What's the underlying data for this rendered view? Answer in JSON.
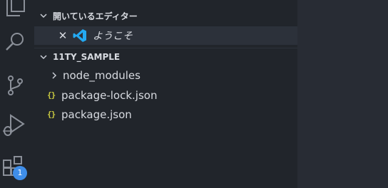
{
  "activity_bar": {
    "items": [
      {
        "name": "explorer",
        "icon": "files-icon"
      },
      {
        "name": "search",
        "icon": "search-icon"
      },
      {
        "name": "source-control",
        "icon": "source-control-icon"
      },
      {
        "name": "run-debug",
        "icon": "run-debug-icon"
      },
      {
        "name": "extensions",
        "icon": "extensions-icon",
        "badge": "1"
      }
    ]
  },
  "sidebar": {
    "open_editors": {
      "title": "開いているエディター",
      "items": [
        {
          "close": "✕",
          "icon": "vscode-icon",
          "label": "ようこそ"
        }
      ]
    },
    "project": {
      "title": "11TY_SAMPLE",
      "items": [
        {
          "type": "folder",
          "label": "node_modules"
        },
        {
          "type": "file",
          "icon": "{}",
          "label": "package-lock.json"
        },
        {
          "type": "file",
          "icon": "{}",
          "label": "package.json"
        }
      ]
    }
  },
  "colors": {
    "sidebar_bg": "#21252b",
    "editor_bg": "#282c34",
    "json_icon": "#cbcb41",
    "badge": "#3f8ee9",
    "vscode_blue": "#23a9f2"
  }
}
